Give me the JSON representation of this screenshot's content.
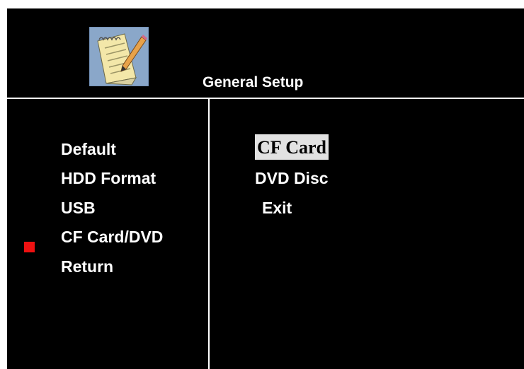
{
  "screen": {
    "title": "General Setup",
    "app_icon": "notepad-pencil-icon"
  },
  "menu": {
    "items": [
      {
        "label": "Default"
      },
      {
        "label": "HDD Format"
      },
      {
        "label": "USB"
      },
      {
        "label": "CF Card/DVD",
        "selected": true
      },
      {
        "label": "Return"
      }
    ],
    "marker_color": "#ee1111"
  },
  "submenu": {
    "items": [
      {
        "label": "CF Card",
        "highlighted": true
      },
      {
        "label": "DVD Disc"
      },
      {
        "label": "Exit"
      }
    ],
    "highlight_color": "#e2e2e2"
  },
  "colors": {
    "background": "#000000",
    "text": "#ffffff"
  }
}
